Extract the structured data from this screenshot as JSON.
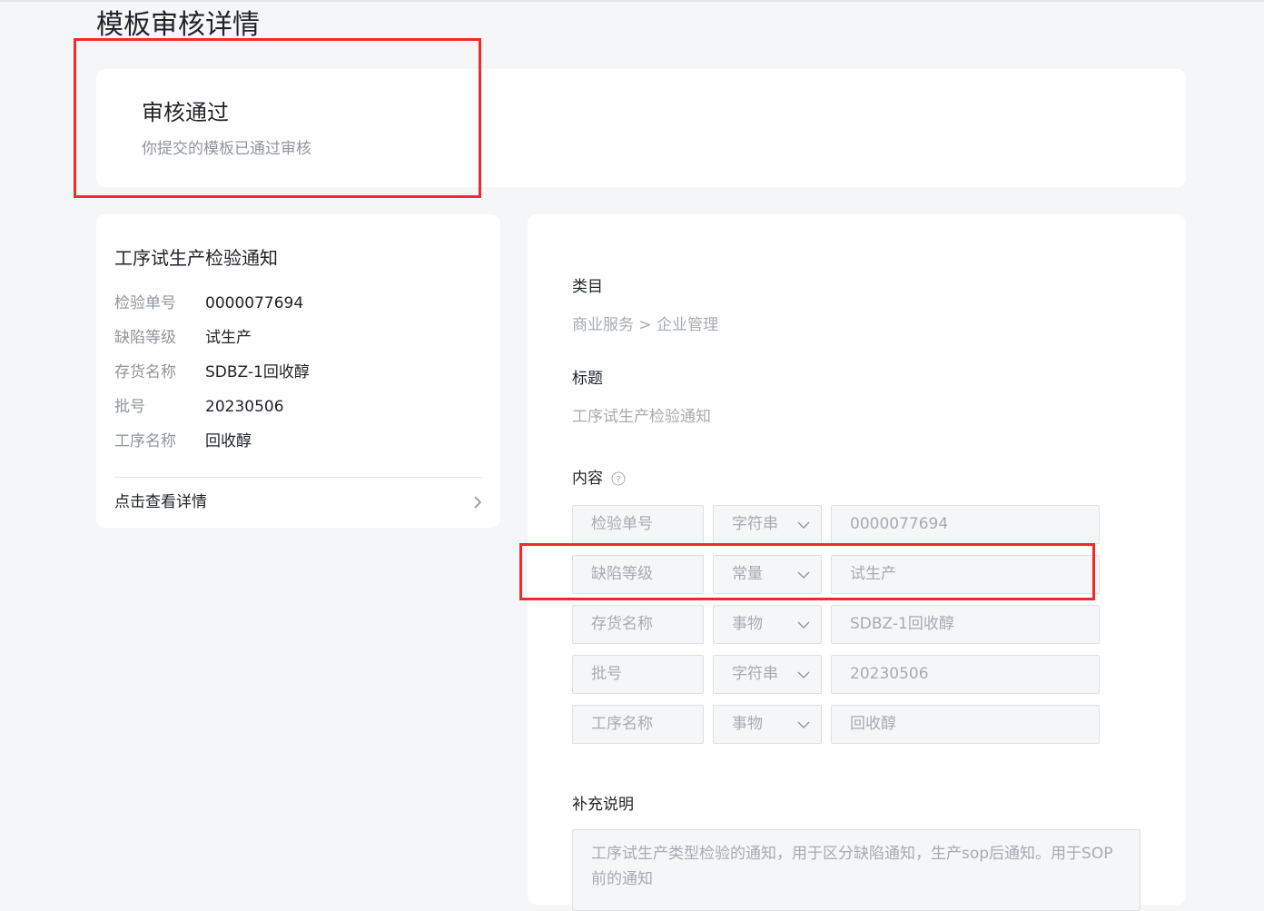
{
  "page": {
    "title": "模板审核详情"
  },
  "status": {
    "title": "审核通过",
    "description": "你提交的模板已通过审核"
  },
  "preview": {
    "title": "工序试生产检验通知",
    "rows": [
      {
        "key": "检验单号",
        "value": "0000077694"
      },
      {
        "key": "缺陷等级",
        "value": "试生产"
      },
      {
        "key": "存货名称",
        "value": "SDBZ-1回收醇"
      },
      {
        "key": "批号",
        "value": "20230506"
      },
      {
        "key": "工序名称",
        "value": "回收醇"
      }
    ],
    "link_label": "点击查看详情"
  },
  "form": {
    "category_label": "类目",
    "category_value": "商业服务 > 企业管理",
    "title_label": "标题",
    "title_value": "工序试生产检验通知",
    "content_label": "内容",
    "content_rows": [
      {
        "key": "检验单号",
        "type": "字符串",
        "value": "0000077694"
      },
      {
        "key": "缺陷等级",
        "type": "常量",
        "value": "试生产"
      },
      {
        "key": "存货名称",
        "type": "事物",
        "value": "SDBZ-1回收醇"
      },
      {
        "key": "批号",
        "type": "字符串",
        "value": "20230506"
      },
      {
        "key": "工序名称",
        "type": "事物",
        "value": "回收醇"
      }
    ],
    "notes_label": "补充说明",
    "notes_value": "工序试生产类型检验的通知，用于区分缺陷通知，生产sop后通知。用于SOP前的通知"
  },
  "colors": {
    "highlight_box": "#f02b2b",
    "background": "#f5f6f7",
    "card": "#ffffff",
    "muted_text": "#8f959e",
    "placeholder_text": "#a6abb3"
  }
}
